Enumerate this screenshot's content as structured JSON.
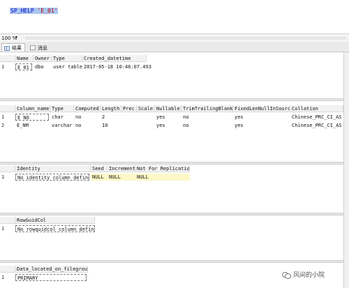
{
  "editor": {
    "sql": {
      "keyword": "SP_HELP",
      "arg": "'E_01'"
    }
  },
  "zoom": {
    "level": "100 %",
    "caret": "▾"
  },
  "tabs": {
    "results": "结果",
    "messages": "消息"
  },
  "grid1": {
    "headers": [
      "Name",
      "Owner",
      "Type",
      "Created_datetime"
    ],
    "rows": [
      {
        "rn": "1",
        "cells": [
          "E_01",
          "dbo",
          "user table",
          "2017-05-18 10:46:07.493"
        ]
      }
    ]
  },
  "grid2": {
    "headers": [
      "Column_name",
      "Type",
      "Computed",
      "Length",
      "Prec",
      "Scale",
      "Nullable",
      "TrimTrailingBlanks",
      "FixedLenNullInSource",
      "Collation"
    ],
    "rows": [
      {
        "rn": "1",
        "cells": [
          "E_NO",
          "char",
          "no",
          "2",
          "",
          "",
          "yes",
          "no",
          "yes",
          "Chinese_PRC_CI_AS"
        ]
      },
      {
        "rn": "2",
        "cells": [
          "E_NM",
          "varchar",
          "no",
          "10",
          "",
          "",
          "yes",
          "no",
          "yes",
          "Chinese_PRC_CI_AS"
        ]
      }
    ]
  },
  "grid3": {
    "headers": [
      "Identity",
      "Seed",
      "Increment",
      "Not For Replication"
    ],
    "rows": [
      {
        "rn": "1",
        "cells": [
          "No identity column defined.",
          "NULL",
          "NULL",
          "NULL"
        ]
      }
    ]
  },
  "grid4": {
    "headers": [
      "RowGuidCol"
    ],
    "rows": [
      {
        "rn": "1",
        "cells": [
          "No rowguidcol column defined."
        ]
      }
    ]
  },
  "grid5": {
    "headers": [
      "Data_located_on_filegroup"
    ],
    "rows": [
      {
        "rn": "1",
        "cells": [
          "PRIMARY"
        ]
      }
    ]
  },
  "watermark": {
    "text": "风间的小院"
  }
}
